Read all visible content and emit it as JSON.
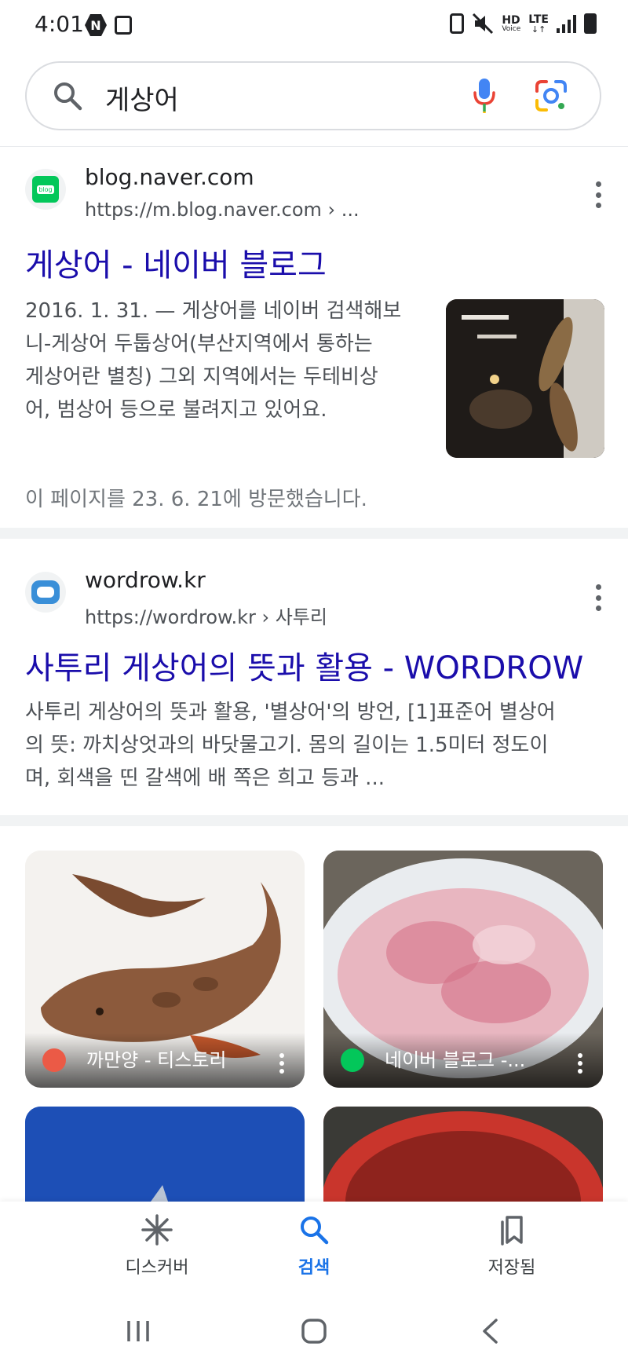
{
  "status_bar": {
    "time": "4:01",
    "network": "HD",
    "lte": "LTE",
    "voice": "Voice"
  },
  "search": {
    "query": "게상어"
  },
  "results": [
    {
      "site": "blog.naver.com",
      "url": "https://m.blog.naver.com › ...",
      "favicon_text": "blog",
      "title": "게상어 - 네이버 블로그",
      "snippet_lines": [
        "2016. 1. 31. — 게상어를 네이버 검색해보",
        "니-게상어 두툽상어(부산지역에서 통하는",
        "게상어란 별칭) 그외 지역에서는 두테비상",
        "어, 범상어 등으로 불려지고 있어요."
      ],
      "visited": "이 페이지를 23. 6. 21에 방문했습니다."
    },
    {
      "site": "wordrow.kr",
      "url": "https://wordrow.kr › 사투리",
      "title": "사투리 게상어의 뜻과 활용 - WORDROW",
      "snippet_lines": [
        "사투리 게상어의 뜻과 활용, '별상어'의 방언, [1]표준어 별상어",
        "의 뜻: 까치상엇과의 바닷물고기. 몸의 길이는 1.5미터 정도이",
        "며, 회색을 띤 갈색에 배 쪽은 희고 등과 ..."
      ]
    }
  ],
  "images": [
    {
      "caption": "까만양 - 티스토리",
      "fav_color": "#eb5a46",
      "fav_text": "T"
    },
    {
      "caption": "네이버 블로그 -...",
      "fav_color": "#03c75a",
      "fav_text": "blog"
    }
  ],
  "bottom_nav": [
    {
      "label": "디스커버",
      "icon": "asterisk-icon",
      "active": false
    },
    {
      "label": "검색",
      "icon": "search-icon",
      "active": true
    },
    {
      "label": "저장됨",
      "icon": "bookmark-icon",
      "active": false
    }
  ],
  "colors": {
    "link": "#1a0dab",
    "active_nav": "#1a73e8",
    "divider": "#f1f3f4"
  }
}
